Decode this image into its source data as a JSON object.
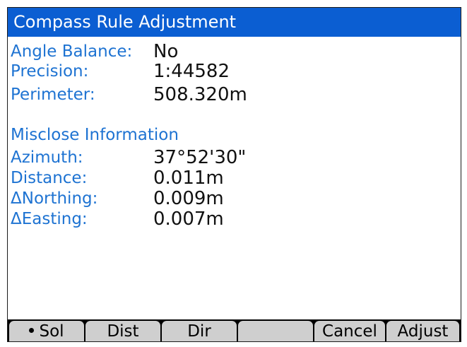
{
  "title": "Compass Rule Adjustment",
  "summary": [
    {
      "label": "Angle Balance:",
      "value": "No"
    },
    {
      "label": "Precision:",
      "value": "1:44582"
    },
    {
      "label": "Perimeter:",
      "value": "508.320m"
    }
  ],
  "misclose": {
    "heading": "Misclose Information",
    "rows": [
      {
        "label": "Azimuth:",
        "value": "37°52'30\""
      },
      {
        "label": "Distance:",
        "value": "0.011m"
      },
      {
        "label": "ΔNorthing:",
        "value": "0.009m"
      },
      {
        "label": "ΔEasting:",
        "value": "0.007m"
      }
    ]
  },
  "softkeys": {
    "sol": "Sol",
    "dist": "Dist",
    "dir": "Dir",
    "blank": "",
    "cancel": "Cancel",
    "adjust": "Adjust"
  },
  "colors": {
    "title_bar": "#0b5ed2",
    "label_text": "#1e73d2",
    "value_text": "#111111",
    "softkey_bg": "#cfcfcf"
  }
}
